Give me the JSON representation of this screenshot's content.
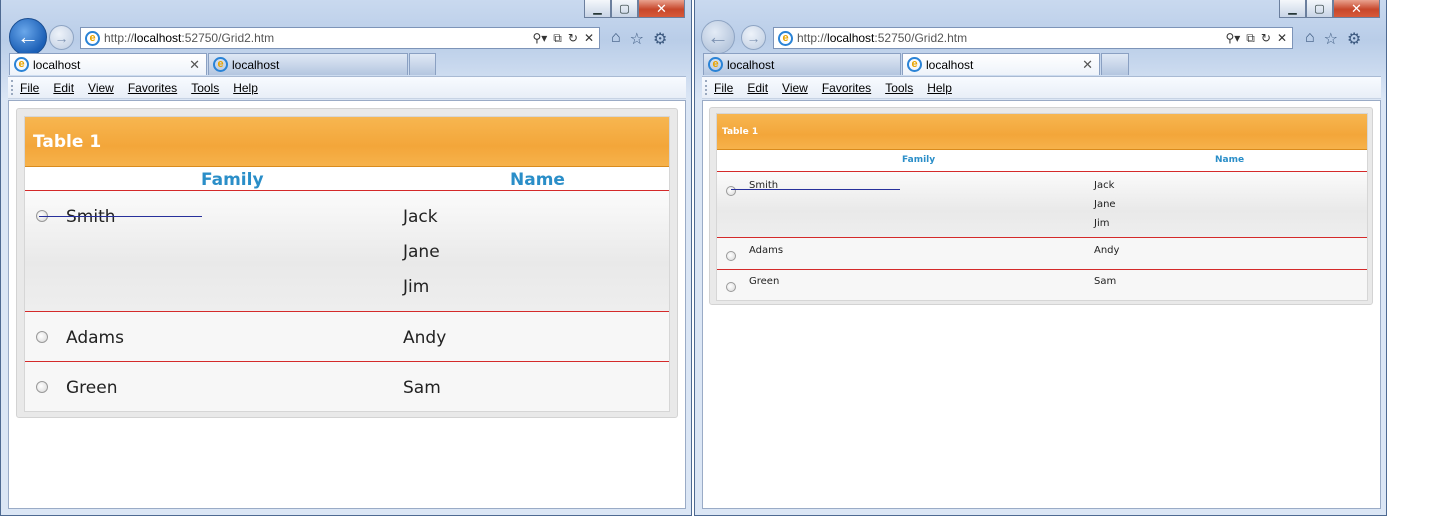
{
  "windows": [
    {
      "url_prefix": "http://",
      "url_host": "localhost",
      "url_rest": ":52750/Grid2.htm",
      "tabs": [
        {
          "label": "localhost",
          "active": true
        },
        {
          "label": "localhost",
          "active": false
        }
      ],
      "menu": [
        "File",
        "Edit",
        "View",
        "Favorites",
        "Tools",
        "Help"
      ],
      "table": {
        "title": "Table 1",
        "columns": [
          "Family",
          "Name"
        ],
        "rows": [
          {
            "family": "Smith",
            "names": [
              "Jack",
              "Jane",
              "Jim"
            ]
          },
          {
            "family": "Adams",
            "names": [
              "Andy"
            ]
          },
          {
            "family": "Green",
            "names": [
              "Sam"
            ]
          }
        ]
      }
    },
    {
      "url_prefix": "http://",
      "url_host": "localhost",
      "url_rest": ":52750/Grid2.htm",
      "tabs": [
        {
          "label": "localhost",
          "active": false
        },
        {
          "label": "localhost",
          "active": true
        }
      ],
      "menu": [
        "File",
        "Edit",
        "View",
        "Favorites",
        "Tools",
        "Help"
      ],
      "table": {
        "title": "Table 1",
        "columns": [
          "Family",
          "Name"
        ],
        "rows": [
          {
            "family": "Smith",
            "names": [
              "Jack",
              "Jane",
              "Jim"
            ]
          },
          {
            "family": "Adams",
            "names": [
              "Andy"
            ]
          },
          {
            "family": "Green",
            "names": [
              "Sam"
            ]
          }
        ]
      }
    }
  ],
  "colors": {
    "header_orange": "#f3a63a",
    "column_header_blue": "#2a8ec8",
    "row_separator_red": "#d42a2a",
    "strike_line_blue": "#27309b"
  },
  "icons": [
    "back-arrow-icon",
    "forward-arrow-icon",
    "ie-logo-icon",
    "search-icon",
    "compat-view-icon",
    "refresh-icon",
    "stop-icon",
    "home-icon",
    "favorites-star-icon",
    "settings-gear-icon",
    "close-icon",
    "minimize-icon",
    "maximize-icon"
  ]
}
